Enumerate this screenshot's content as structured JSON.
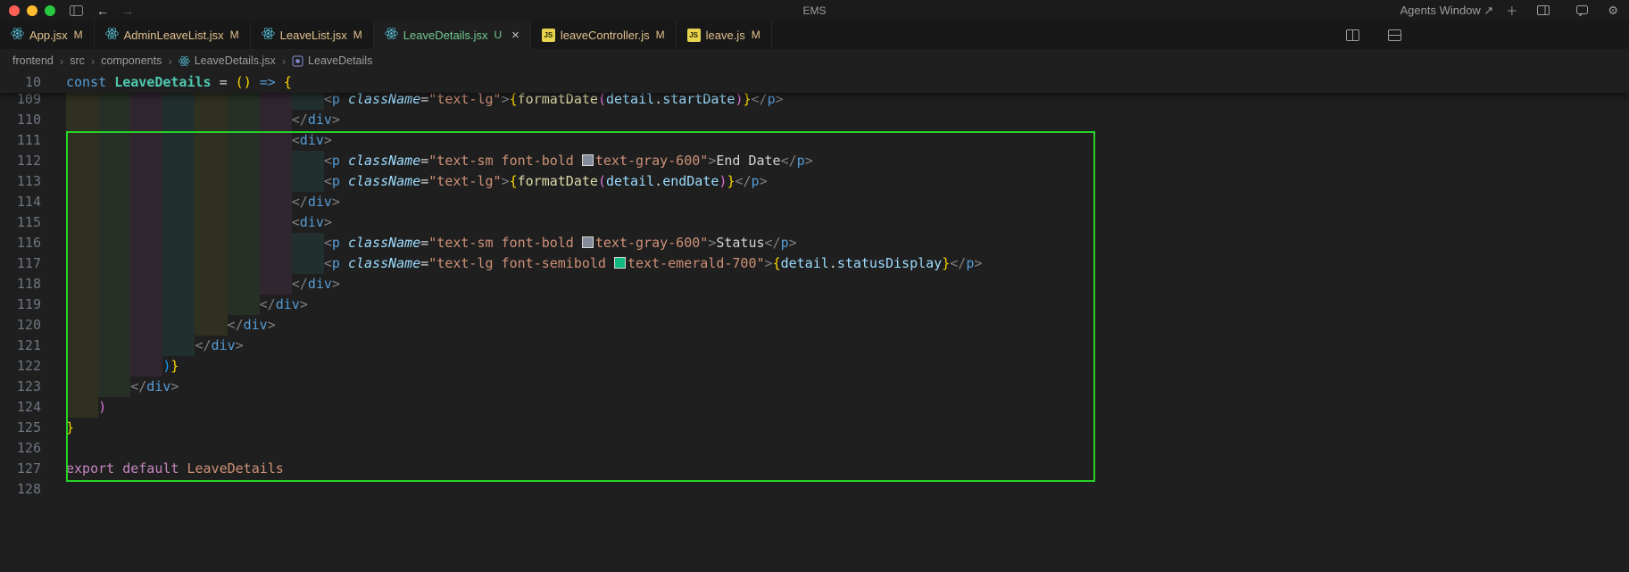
{
  "window": {
    "title": "EMS",
    "agents_label": "Agents Window ↗"
  },
  "tabs": [
    {
      "label": "App.jsx",
      "icon": "react",
      "git": "M",
      "active": false
    },
    {
      "label": "AdminLeaveList.jsx",
      "icon": "react",
      "git": "M",
      "active": false
    },
    {
      "label": "LeaveList.jsx",
      "icon": "react",
      "git": "M",
      "active": false
    },
    {
      "label": "LeaveDetails.jsx",
      "icon": "react",
      "git": "U",
      "active": true,
      "close": "×"
    },
    {
      "label": "leaveController.js",
      "icon": "js",
      "git": "M",
      "active": false
    },
    {
      "label": "leave.js",
      "icon": "js",
      "git": "M",
      "active": false
    }
  ],
  "breadcrumbs": [
    {
      "label": "frontend"
    },
    {
      "label": "src"
    },
    {
      "label": "components"
    },
    {
      "label": "LeaveDetails.jsx",
      "icon": "react"
    },
    {
      "label": "LeaveDetails",
      "icon": "symbol"
    }
  ],
  "colors": {
    "annotation": "#27d227",
    "modified": "#e2c08d",
    "untracked": "#73c991",
    "react_icon": "#58c4dc",
    "js_icon": "#e8d44d",
    "swatch_gray": "#848b98",
    "swatch_emerald": "#10b981"
  },
  "editor": {
    "indent_colors": [
      "rgba(255,255,64,0.08)",
      "rgba(127,255,127,0.08)",
      "rgba(255,127,255,0.08)",
      "rgba(79,236,236,0.08)"
    ],
    "sticky": {
      "num": 10,
      "indent": 0,
      "tokens": [
        [
          "const",
          "kw"
        ],
        [
          " ",
          ""
        ],
        [
          "LeaveDetails",
          "comp"
        ],
        [
          " ",
          ""
        ],
        [
          "=",
          "op"
        ],
        [
          " ",
          ""
        ],
        [
          "(",
          "b1"
        ],
        [
          ")",
          "b1"
        ],
        [
          " ",
          ""
        ],
        [
          "=>",
          "kw"
        ],
        [
          " ",
          ""
        ],
        [
          "{",
          "b1"
        ]
      ]
    },
    "lines": [
      {
        "num": 109,
        "indent": 32,
        "tokens": [
          [
            "<",
            "pn"
          ],
          [
            "p",
            "tag"
          ],
          [
            " ",
            ""
          ],
          [
            "className",
            "attr"
          ],
          [
            "=",
            "op"
          ],
          [
            "\"text-lg\"",
            "str"
          ],
          [
            ">",
            "pn"
          ],
          [
            "{",
            "b1"
          ],
          [
            "formatDate",
            "fn"
          ],
          [
            "(",
            "b2"
          ],
          [
            "detail",
            "var"
          ],
          [
            ".",
            "op"
          ],
          [
            "startDate",
            "var"
          ],
          [
            ")",
            "b2"
          ],
          [
            "}",
            "b1"
          ],
          [
            "</",
            "pn"
          ],
          [
            "p",
            "tag"
          ],
          [
            ">",
            "pn"
          ]
        ]
      },
      {
        "num": 110,
        "indent": 28,
        "tokens": [
          [
            "</",
            "pn"
          ],
          [
            "div",
            "tag"
          ],
          [
            ">",
            "pn"
          ]
        ]
      },
      {
        "num": 111,
        "indent": 28,
        "tokens": [
          [
            "<",
            "pn"
          ],
          [
            "div",
            "tag"
          ],
          [
            ">",
            "pn"
          ]
        ]
      },
      {
        "num": 112,
        "indent": 32,
        "tokens": [
          [
            "<",
            "pn"
          ],
          [
            "p",
            "tag"
          ],
          [
            " ",
            ""
          ],
          [
            "className",
            "attr"
          ],
          [
            "=",
            "op"
          ],
          [
            "\"text-sm font-bold ",
            "str"
          ],
          {
            "sw": "swatch_gray"
          },
          [
            "text-gray-600\"",
            "str"
          ],
          [
            ">",
            "pn"
          ],
          [
            "End Date",
            "txt"
          ],
          [
            "</",
            "pn"
          ],
          [
            "p",
            "tag"
          ],
          [
            ">",
            "pn"
          ]
        ]
      },
      {
        "num": 113,
        "indent": 32,
        "tokens": [
          [
            "<",
            "pn"
          ],
          [
            "p",
            "tag"
          ],
          [
            " ",
            ""
          ],
          [
            "className",
            "attr"
          ],
          [
            "=",
            "op"
          ],
          [
            "\"text-lg\"",
            "str"
          ],
          [
            ">",
            "pn"
          ],
          [
            "{",
            "b1"
          ],
          [
            "formatDate",
            "fn"
          ],
          [
            "(",
            "b2"
          ],
          [
            "detail",
            "var"
          ],
          [
            ".",
            "op"
          ],
          [
            "endDate",
            "var"
          ],
          [
            ")",
            "b2"
          ],
          [
            "}",
            "b1"
          ],
          [
            "</",
            "pn"
          ],
          [
            "p",
            "tag"
          ],
          [
            ">",
            "pn"
          ]
        ]
      },
      {
        "num": 114,
        "indent": 28,
        "tokens": [
          [
            "</",
            "pn"
          ],
          [
            "div",
            "tag"
          ],
          [
            ">",
            "pn"
          ]
        ]
      },
      {
        "num": 115,
        "indent": 28,
        "tokens": [
          [
            "<",
            "pn"
          ],
          [
            "div",
            "tag"
          ],
          [
            ">",
            "pn"
          ]
        ]
      },
      {
        "num": 116,
        "indent": 32,
        "tokens": [
          [
            "<",
            "pn"
          ],
          [
            "p",
            "tag"
          ],
          [
            " ",
            ""
          ],
          [
            "className",
            "attr"
          ],
          [
            "=",
            "op"
          ],
          [
            "\"text-sm font-bold ",
            "str"
          ],
          {
            "sw": "swatch_gray"
          },
          [
            "text-gray-600\"",
            "str"
          ],
          [
            ">",
            "pn"
          ],
          [
            "Status",
            "txt"
          ],
          [
            "</",
            "pn"
          ],
          [
            "p",
            "tag"
          ],
          [
            ">",
            "pn"
          ]
        ]
      },
      {
        "num": 117,
        "indent": 32,
        "tokens": [
          [
            "<",
            "pn"
          ],
          [
            "p",
            "tag"
          ],
          [
            " ",
            ""
          ],
          [
            "className",
            "attr"
          ],
          [
            "=",
            "op"
          ],
          [
            "\"text-lg font-semibold ",
            "str"
          ],
          {
            "sw": "swatch_emerald"
          },
          [
            "text-emerald-700\"",
            "str"
          ],
          [
            ">",
            "pn"
          ],
          [
            "{",
            "b1"
          ],
          [
            "detail",
            "var"
          ],
          [
            ".",
            "op"
          ],
          [
            "statusDisplay",
            "var"
          ],
          [
            "}",
            "b1"
          ],
          [
            "</",
            "pn"
          ],
          [
            "p",
            "tag"
          ],
          [
            ">",
            "pn"
          ]
        ]
      },
      {
        "num": 118,
        "indent": 28,
        "tokens": [
          [
            "</",
            "pn"
          ],
          [
            "div",
            "tag"
          ],
          [
            ">",
            "pn"
          ]
        ]
      },
      {
        "num": 119,
        "indent": 24,
        "tokens": [
          [
            "</",
            "pn"
          ],
          [
            "div",
            "tag"
          ],
          [
            ">",
            "pn"
          ]
        ]
      },
      {
        "num": 120,
        "indent": 20,
        "tokens": [
          [
            "</",
            "pn"
          ],
          [
            "div",
            "tag"
          ],
          [
            ">",
            "pn"
          ]
        ]
      },
      {
        "num": 121,
        "indent": 16,
        "tokens": [
          [
            "</",
            "pn"
          ],
          [
            "div",
            "tag"
          ],
          [
            ">",
            "pn"
          ]
        ]
      },
      {
        "num": 122,
        "indent": 12,
        "tokens": [
          [
            ")",
            "b3"
          ],
          [
            "}",
            "b1"
          ]
        ]
      },
      {
        "num": 123,
        "indent": 8,
        "tokens": [
          [
            "</",
            "pn"
          ],
          [
            "div",
            "tag"
          ],
          [
            ">",
            "pn"
          ]
        ]
      },
      {
        "num": 124,
        "indent": 4,
        "tokens": [
          [
            ")",
            "b2"
          ]
        ]
      },
      {
        "num": 125,
        "indent": 0,
        "tokens": [
          [
            "}",
            "b1"
          ]
        ]
      },
      {
        "num": 126,
        "indent": 0,
        "tokens": []
      },
      {
        "num": 127,
        "indent": 0,
        "tokens": [
          [
            "export",
            "kw2"
          ],
          [
            " ",
            ""
          ],
          [
            "default",
            "kw2"
          ],
          [
            " ",
            ""
          ],
          [
            "LeaveDetails",
            "warm"
          ]
        ]
      },
      {
        "num": 128,
        "indent": 0,
        "tokens": []
      }
    ]
  }
}
